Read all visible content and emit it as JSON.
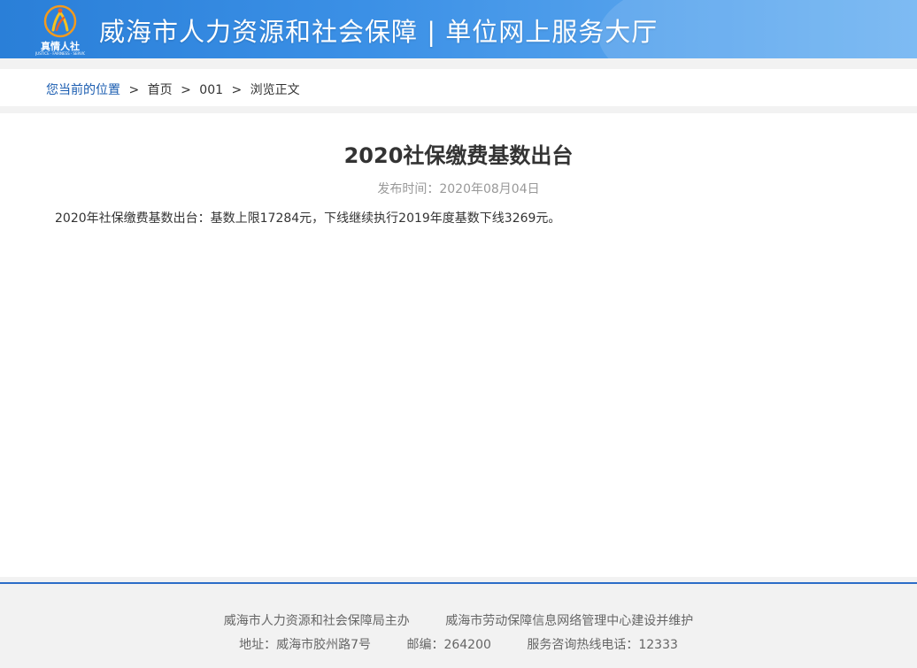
{
  "header": {
    "logo_text": "真情人社",
    "logo_sub": "JUSTICE · FAIRNESS · SERVICE",
    "title": "威海市人力资源和社会保障 | 单位网上服务大厅"
  },
  "breadcrumb": {
    "here": "您当前的位置",
    "sep": ">",
    "items": [
      "首页",
      "001",
      "浏览正文"
    ]
  },
  "article": {
    "title": "2020社保缴费基数出台",
    "publish": "发布时间：2020年08月04日",
    "body": "2020年社保缴费基数出台：基数上限17284元，下线继续执行2019年度基数下线3269元。"
  },
  "footer": {
    "host": "威海市人力资源和社会保障局主办",
    "maintainer": "威海市劳动保障信息网络管理中心建设并维护",
    "address": "地址：威海市胶州路7号",
    "postcode": "邮编：264200",
    "hotline": "服务咨询热线电话：12333"
  },
  "colors": {
    "header_blue": "#2a7fd8",
    "link_blue": "#1a5cb0",
    "footer_line": "#2b6dc8",
    "logo_orange": "#f39a1e"
  }
}
